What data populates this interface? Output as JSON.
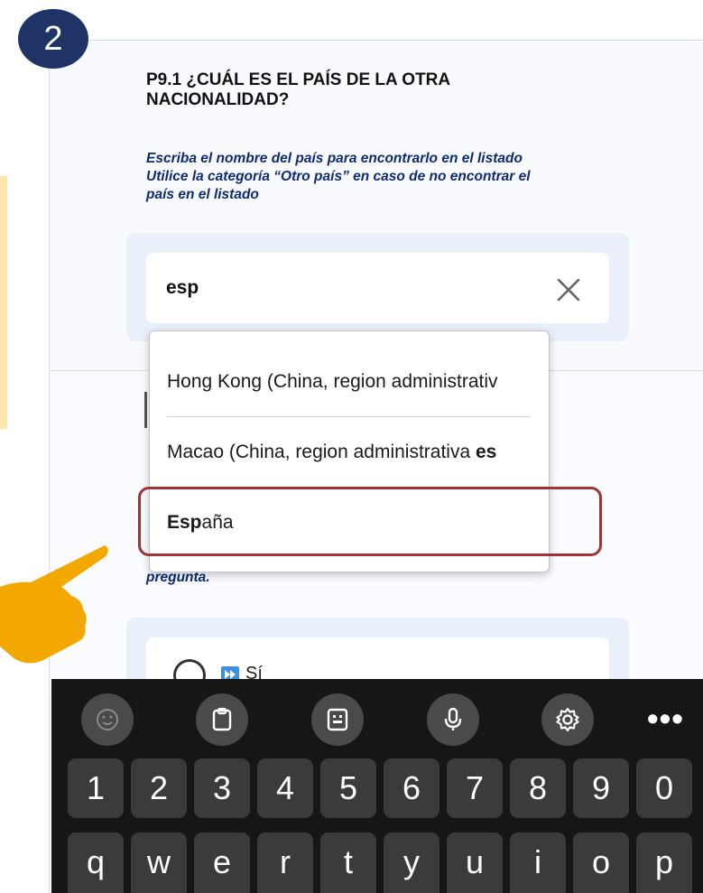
{
  "step_number": "2",
  "question": {
    "title": "P9.1 ¿CUÁL ES EL PAÍS DE LA OTRA NACIONALIDAD?",
    "instructions": [
      "Escriba el nombre del país para encontrarlo en el listado",
      "Utilice la categoría “Otro país” en caso de no encontrar el",
      "país en el listado"
    ]
  },
  "search": {
    "value": "esp"
  },
  "dropdown": {
    "options": [
      {
        "before": "Hong Kong (China, region administrativ",
        "match": "",
        "after": ""
      },
      {
        "before": "Macao (China, region administrativa ",
        "match": "es",
        "after": ""
      },
      {
        "before": "",
        "match": "Esp",
        "after": "aña"
      }
    ],
    "selected": "España"
  },
  "next_block": {
    "partial_text": "pregunta.",
    "option_label": "Sí"
  },
  "keyboard": {
    "tools": [
      "emoji-icon",
      "clipboard-icon",
      "keyboard-layout-icon",
      "microphone-icon",
      "settings-icon"
    ],
    "more": "•••",
    "number_row": [
      "1",
      "2",
      "3",
      "4",
      "5",
      "6",
      "7",
      "8",
      "9",
      "0"
    ],
    "letter_row": [
      "q",
      "w",
      "e",
      "r",
      "t",
      "y",
      "u",
      "i",
      "o",
      "p"
    ]
  },
  "colors": {
    "badge": "#1f3366",
    "instruction_text": "#0e2b72",
    "selection_outline": "#a03238",
    "pointer": "#f3a800"
  }
}
